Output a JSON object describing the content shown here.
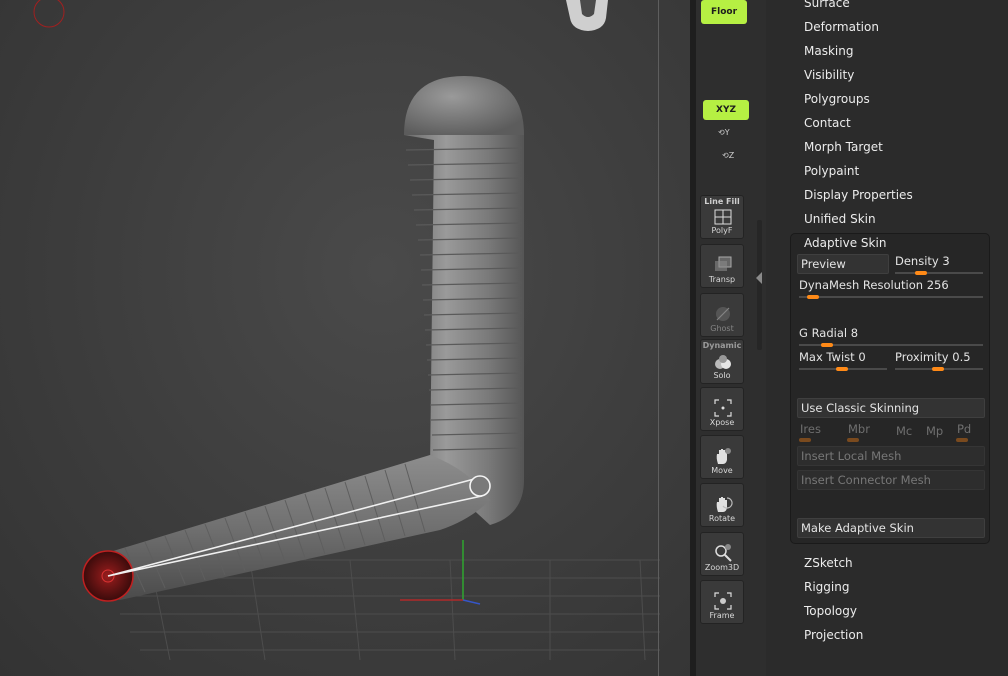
{
  "shelf": {
    "floor_label": "Floor",
    "xyz_label": "XYZ",
    "y_label": "Y",
    "z_label": "Z",
    "polyf": {
      "top": "Line Fill",
      "label": "PolyF"
    },
    "transp": {
      "label": "Transp"
    },
    "ghost": {
      "label": "Ghost"
    },
    "solo": {
      "top": "Dynamic",
      "label": "Solo"
    },
    "xpose": {
      "label": "Xpose"
    },
    "move": {
      "label": "Move"
    },
    "rotate": {
      "label": "Rotate"
    },
    "zoom3d": {
      "label": "Zoom3D"
    },
    "frame": {
      "label": "Frame"
    }
  },
  "menu": {
    "items_top": [
      "Surface",
      "Deformation",
      "Masking",
      "Visibility",
      "Polygroups",
      "Contact",
      "Morph Target",
      "Polypaint",
      "Display Properties",
      "Unified Skin"
    ],
    "adaptive_title": "Adaptive Skin",
    "preview": "Preview",
    "density_label": "Density",
    "density_value": "3",
    "dynamesh_label": "DynaMesh Resolution",
    "dynamesh_value": "256",
    "gradial_label": "G Radial",
    "gradial_value": "8",
    "maxtwist_label": "Max Twist",
    "maxtwist_value": "0",
    "proximity_label": "Proximity",
    "proximity_value": "0.5",
    "classic": "Use Classic Skinning",
    "ires": "Ires",
    "mbr": "Mbr",
    "mc": "Mc",
    "mp": "Mp",
    "pd": "Pd",
    "insert_local": "Insert Local Mesh",
    "insert_connector": "Insert Connector Mesh",
    "make": "Make Adaptive Skin",
    "items_bottom": [
      "ZSketch",
      "Rigging",
      "Topology",
      "Projection"
    ]
  },
  "colors": {
    "accent_green": "#b6f043",
    "slider_orange": "#ff8a17"
  }
}
